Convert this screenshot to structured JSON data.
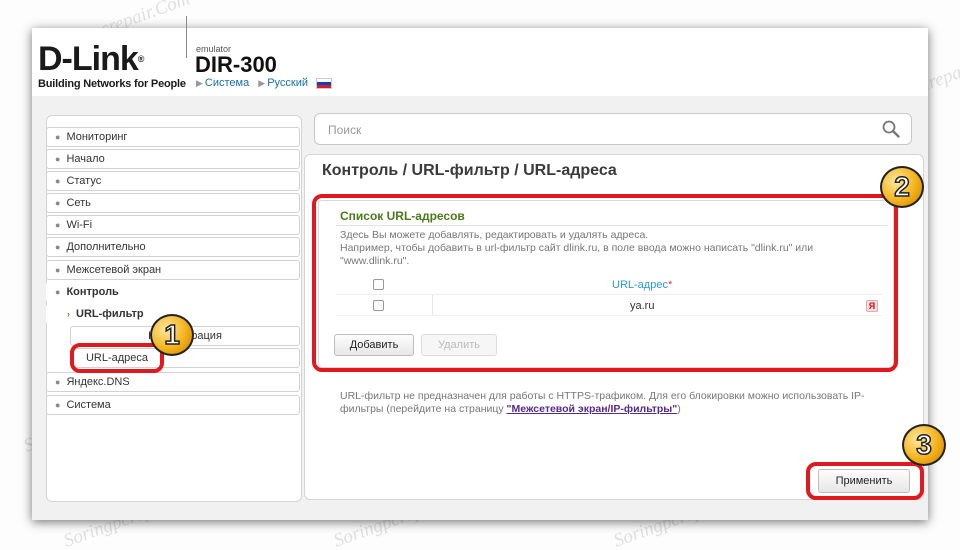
{
  "header": {
    "brand": "D-Link",
    "brand_mark": "®",
    "tagline": "Building Networks for People",
    "emulator_label": "emulator",
    "model": "DIR-300",
    "crumb_system": "Система",
    "crumb_language": "Русский"
  },
  "sidebar": {
    "items": [
      {
        "label": "Мониторинг"
      },
      {
        "label": "Начало"
      },
      {
        "label": "Статус"
      },
      {
        "label": "Сеть"
      },
      {
        "label": "Wi-Fi"
      },
      {
        "label": "Дополнительно"
      },
      {
        "label": "Межсетевой экран"
      },
      {
        "label": "Контроль"
      },
      {
        "label": "URL-фильтр"
      },
      {
        "label": "Конфигурация"
      },
      {
        "label": "URL-адреса"
      },
      {
        "label": "Яндекс.DNS"
      },
      {
        "label": "Система"
      }
    ]
  },
  "search": {
    "placeholder": "Поиск"
  },
  "main": {
    "title": "Контроль /  URL-фильтр /  URL-адреса",
    "section_title": "Список URL-адресов",
    "desc_line1": "Здесь Вы можете добавлять, редактировать и удалять адреса.",
    "desc_line2": "Например, чтобы добавить в url-фильтр сайт dlink.ru, в поле ввода можно написать \"dlink.ru\" или \"www.dlink.ru\".",
    "column_header": "URL-адрес",
    "required_mark": "*",
    "rows": [
      {
        "url": "ya.ru"
      }
    ],
    "add_button": "Добавить",
    "delete_button": "Удалить",
    "note_text": "URL-фильтр не предназначен для работы с HTTPS-трафиком. Для его блокировки можно использовать IP-фильтры (перейдите на страницу ",
    "note_link": "\"Межсетевой экран/IP-фильтры\"",
    "note_end": ")",
    "apply_button": "Применить"
  },
  "annotations": {
    "badge1": "1",
    "badge2": "2",
    "badge3": "3"
  },
  "watermark": "Soringpcrepair.Com",
  "colors": {
    "highlight": "#e0191e",
    "section_title": "#4b7a1a",
    "link": "#2a9ad6"
  }
}
